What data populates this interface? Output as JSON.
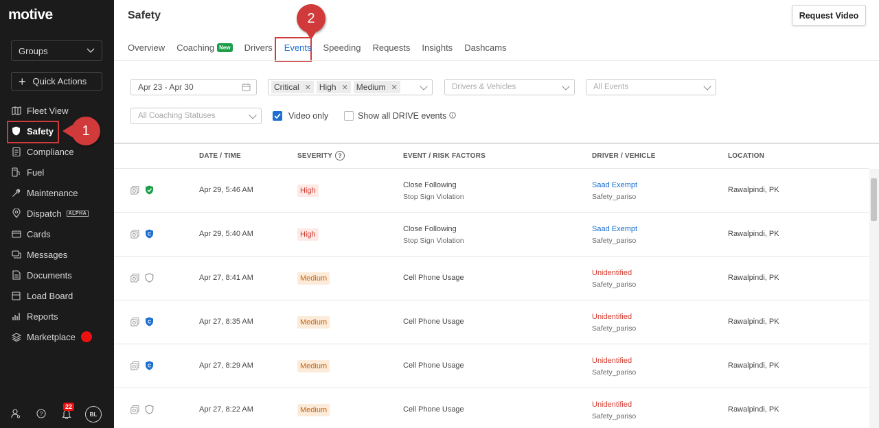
{
  "sidebar": {
    "logo": "motive",
    "groups_label": "Groups",
    "quick_actions_label": "Quick Actions",
    "items": [
      {
        "label": "Fleet View",
        "icon": "map-icon"
      },
      {
        "label": "Safety",
        "icon": "shield-icon"
      },
      {
        "label": "Compliance",
        "icon": "clipboard-icon"
      },
      {
        "label": "Fuel",
        "icon": "fuel-icon"
      },
      {
        "label": "Maintenance",
        "icon": "wrench-icon"
      },
      {
        "label": "Dispatch",
        "icon": "location-pin-icon",
        "badge": "ALPHA"
      },
      {
        "label": "Cards",
        "icon": "card-icon"
      },
      {
        "label": "Messages",
        "icon": "chat-icon"
      },
      {
        "label": "Documents",
        "icon": "document-icon"
      },
      {
        "label": "Load Board",
        "icon": "box-icon"
      },
      {
        "label": "Reports",
        "icon": "bar-chart-icon"
      },
      {
        "label": "Marketplace",
        "icon": "layers-icon"
      }
    ],
    "notifications_count": "22",
    "avatar_initials": "BL"
  },
  "callouts": {
    "one": "1",
    "two": "2"
  },
  "header": {
    "title": "Safety",
    "request_video_label": "Request Video",
    "tabs": [
      {
        "label": "Overview"
      },
      {
        "label": "Coaching",
        "badge": "New"
      },
      {
        "label": "Drivers"
      },
      {
        "label": "Events"
      },
      {
        "label": "Speeding"
      },
      {
        "label": "Requests"
      },
      {
        "label": "Insights"
      },
      {
        "label": "Dashcams"
      }
    ]
  },
  "filters": {
    "date_range": "Apr 23 - Apr 30",
    "severity_tags": [
      "Critical",
      "High",
      "Medium"
    ],
    "drivers_vehicles_placeholder": "Drivers & Vehicles",
    "events_placeholder": "All Events",
    "coaching_placeholder": "All Coaching Statuses",
    "video_only_label": "Video only",
    "video_only_checked": true,
    "show_drive_label": "Show all DRIVE events",
    "show_drive_checked": false
  },
  "table": {
    "columns": [
      "DATE / TIME",
      "SEVERITY",
      "EVENT / RISK FACTORS",
      "DRIVER / VEHICLE",
      "LOCATION"
    ],
    "rows": [
      {
        "datetime": "Apr 29, 5:46 AM",
        "severity": "High",
        "event": "Close Following",
        "risk": "Stop Sign Violation",
        "driver": "Saad Exempt",
        "vehicle": "Safety_pariso",
        "location": "Rawalpindi, PK",
        "status_icon": "shield-check-icon"
      },
      {
        "datetime": "Apr 29, 5:40 AM",
        "severity": "High",
        "event": "Close Following",
        "risk": "Stop Sign Violation",
        "driver": "Saad Exempt",
        "vehicle": "Safety_pariso",
        "location": "Rawalpindi, PK",
        "status_icon": "shield-coach-icon"
      },
      {
        "datetime": "Apr 27, 8:41 AM",
        "severity": "Medium",
        "event": "Cell Phone Usage",
        "risk": "",
        "driver": "Unidentified",
        "vehicle": "Safety_pariso",
        "location": "Rawalpindi, PK",
        "status_icon": "shield-outline-icon"
      },
      {
        "datetime": "Apr 27, 8:35 AM",
        "severity": "Medium",
        "event": "Cell Phone Usage",
        "risk": "",
        "driver": "Unidentified",
        "vehicle": "Safety_pariso",
        "location": "Rawalpindi, PK",
        "status_icon": "shield-coach-icon"
      },
      {
        "datetime": "Apr 27, 8:29 AM",
        "severity": "Medium",
        "event": "Cell Phone Usage",
        "risk": "",
        "driver": "Unidentified",
        "vehicle": "Safety_pariso",
        "location": "Rawalpindi, PK",
        "status_icon": "shield-coach-icon"
      },
      {
        "datetime": "Apr 27, 8:22 AM",
        "severity": "Medium",
        "event": "Cell Phone Usage",
        "risk": "",
        "driver": "Unidentified",
        "vehicle": "Safety_pariso",
        "location": "Rawalpindi, PK",
        "status_icon": "shield-outline-icon"
      }
    ]
  },
  "colors": {
    "accent": "#1b6fd1",
    "callout": "#d03a3a",
    "sidebar": "#1b1b1b"
  }
}
